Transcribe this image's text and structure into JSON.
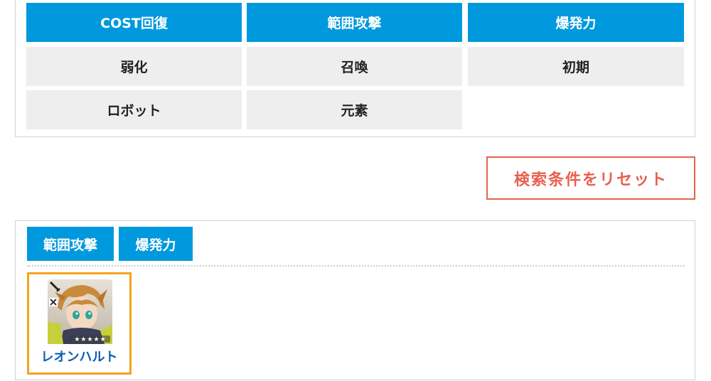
{
  "filters": {
    "row1": [
      "COST回復",
      "範囲攻撃",
      "爆発力"
    ],
    "row2": [
      "弱化",
      "召喚",
      "初期"
    ],
    "row3": [
      "ロボット",
      "元素"
    ]
  },
  "reset_label": "検索条件をリセット",
  "results": {
    "chips": [
      "範囲攻撃",
      "爆発力"
    ],
    "character": {
      "name": "レオンハルト",
      "stars": "★★★★★"
    }
  },
  "colors": {
    "active": "#0099dd",
    "inactive": "#eeeeee",
    "reset": "#e86050",
    "card_border": "#f5a31a",
    "name": "#0a5fb0"
  }
}
